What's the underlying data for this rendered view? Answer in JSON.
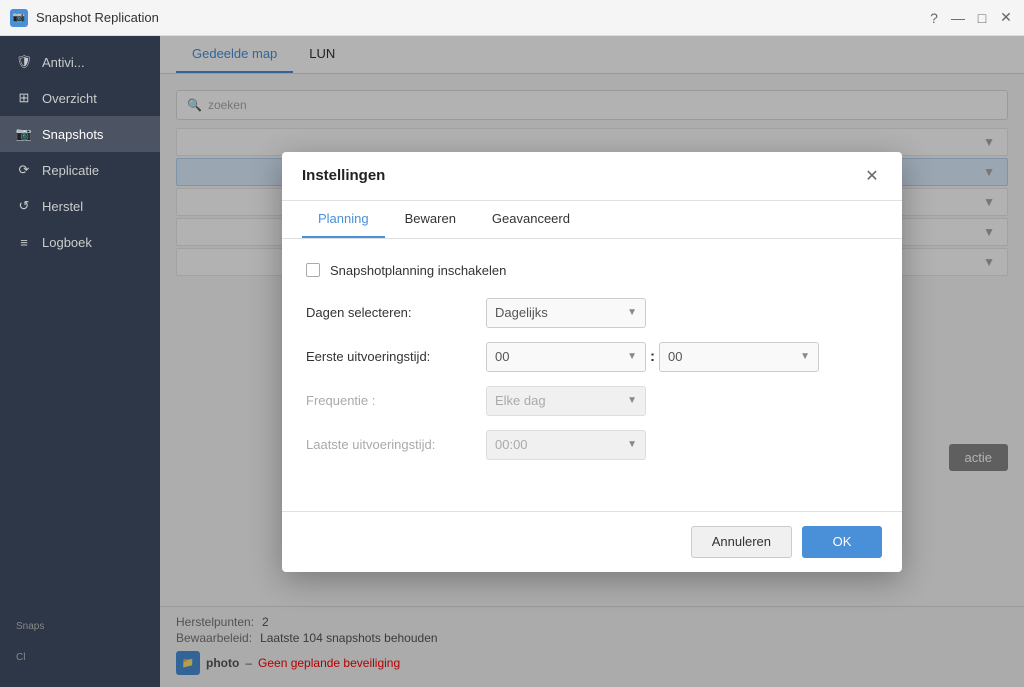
{
  "app": {
    "title": "Snapshot Replication",
    "icon": "📷"
  },
  "titlebar": {
    "controls": [
      "?",
      "—",
      "□",
      "✕"
    ]
  },
  "sidebar": {
    "items": [
      {
        "id": "antivirus",
        "label": "Antivi...",
        "icon": "🛡"
      },
      {
        "id": "overzicht",
        "label": "Overzicht",
        "icon": "⊞"
      },
      {
        "id": "snapshots",
        "label": "Snapshots",
        "icon": "📷",
        "active": true
      },
      {
        "id": "replicatie",
        "label": "Replicatie",
        "icon": "⟳"
      },
      {
        "id": "herstel",
        "label": "Herstel",
        "icon": "↺"
      },
      {
        "id": "logboek",
        "label": "Logboek",
        "icon": "≡"
      }
    ],
    "section_labels": [
      "Snaps",
      "Cl"
    ]
  },
  "main_tabs": [
    {
      "id": "gedeelde-map",
      "label": "Gedeelde map",
      "active": true
    },
    {
      "id": "lun",
      "label": "LUN"
    }
  ],
  "content": {
    "search_placeholder": "zoeken",
    "rows": [
      {
        "id": "row1",
        "has_arrow": true,
        "selected": false
      },
      {
        "id": "row2",
        "has_arrow": true,
        "selected": true
      },
      {
        "id": "row3",
        "has_arrow": true,
        "selected": false
      },
      {
        "id": "row4",
        "has_arrow": true,
        "selected": false
      },
      {
        "id": "row5",
        "has_arrow": true,
        "selected": false
      }
    ]
  },
  "bottom": {
    "herstelpunten_label": "Herstelpunten:",
    "herstelpunten_value": "2",
    "bewaarbeleid_label": "Bewaarbeleid:",
    "bewaarbeleid_value": "Laatste 104 snapshots behouden",
    "photo_name": "photo",
    "photo_link": "Geen geplande beveiliging"
  },
  "modal": {
    "title": "Instellingen",
    "close_label": "✕",
    "tabs": [
      {
        "id": "planning",
        "label": "Planning",
        "active": true
      },
      {
        "id": "bewaren",
        "label": "Bewaren"
      },
      {
        "id": "geavanceerd",
        "label": "Geavanceerd"
      }
    ],
    "checkbox": {
      "label": "Snapshotplanning inschakelen",
      "checked": false
    },
    "fields": [
      {
        "id": "dagen-selecteren",
        "label": "Dagen selecteren:",
        "type": "select",
        "value": "Dagelijks",
        "disabled": false
      },
      {
        "id": "eerste-uitvoeringstijd",
        "label": "Eerste uitvoeringstijd:",
        "type": "time",
        "hour": "00",
        "minute": "00",
        "disabled": false
      },
      {
        "id": "frequentie",
        "label": "Frequentie :",
        "type": "select",
        "value": "Elke dag",
        "disabled": true
      },
      {
        "id": "laatste-uitvoeringstijd",
        "label": "Laatste uitvoeringstijd:",
        "type": "select",
        "value": "00:00",
        "disabled": true
      }
    ],
    "footer": {
      "cancel_label": "Annuleren",
      "ok_label": "OK"
    }
  }
}
